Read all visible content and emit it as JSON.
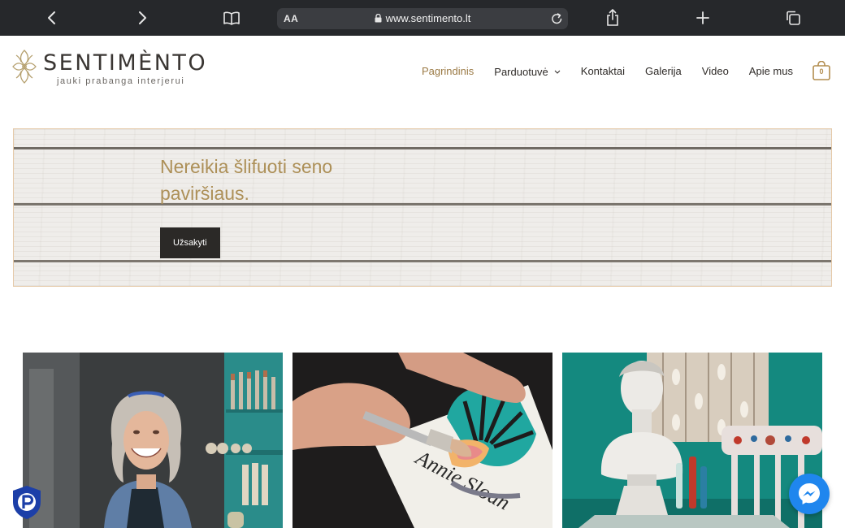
{
  "browser": {
    "url": "www.sentimento.lt",
    "text_size_label": "AA"
  },
  "site": {
    "logo_name": "SENTIMÈNTO",
    "logo_tagline": "jauki prabanga interjerui",
    "brand_color": "#ad9058"
  },
  "nav": {
    "items": [
      {
        "label": "Pagrindinis",
        "active": true
      },
      {
        "label": "Parduotuvė",
        "dropdown": true
      },
      {
        "label": "Kontaktai"
      },
      {
        "label": "Galerija"
      },
      {
        "label": "Video"
      },
      {
        "label": "Apie mus"
      }
    ],
    "cart_count": "0"
  },
  "hero": {
    "title": "Nereikia šlifuoti seno paviršiaus.",
    "button_label": "Užsakyti"
  },
  "tiles": [
    {
      "icon": "woman-with-paintbrushes-photo"
    },
    {
      "icon": "hands-painting-stencil-photo"
    },
    {
      "icon": "painted-bust-and-chair-photo"
    }
  ]
}
